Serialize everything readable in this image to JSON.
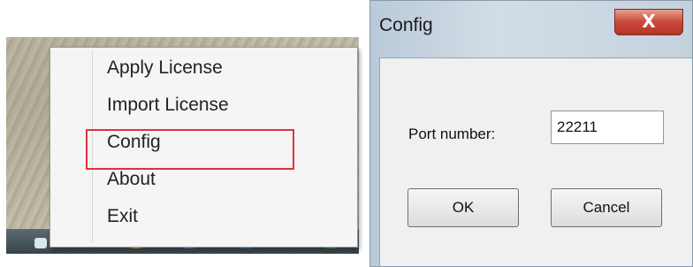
{
  "context_menu": {
    "items": [
      {
        "label": "Apply License"
      },
      {
        "label": "Import License"
      },
      {
        "label": "Config"
      },
      {
        "label": "About"
      },
      {
        "label": "Exit"
      }
    ],
    "highlighted": "Config",
    "highlight_color": "#e0323a"
  },
  "dialog": {
    "title": "Config",
    "close_glyph": "X",
    "port_label": "Port number:",
    "port_value": "22211",
    "ok_label": "OK",
    "cancel_label": "Cancel"
  }
}
